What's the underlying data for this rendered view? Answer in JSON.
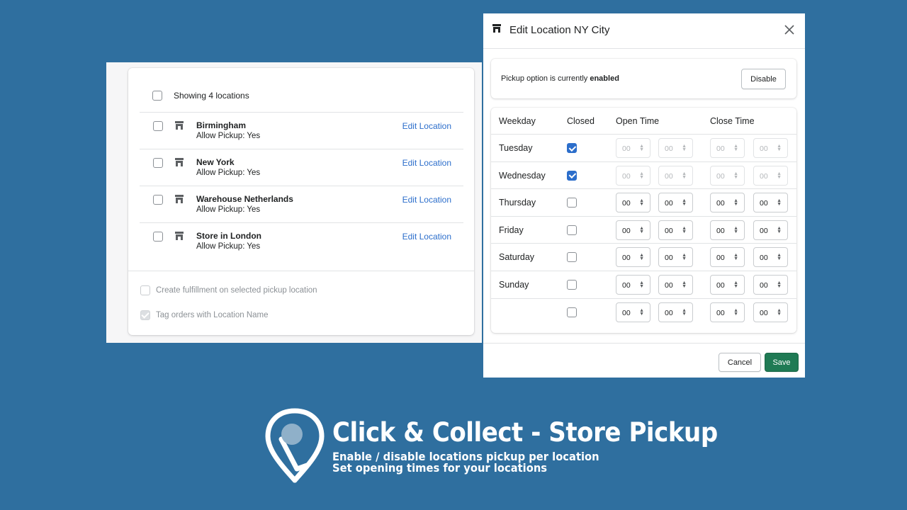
{
  "locations": {
    "header_label": "Showing 4 locations",
    "items": [
      {
        "name": "Birmingham",
        "allow": "Allow Pickup: Yes",
        "edit": "Edit Location"
      },
      {
        "name": "New York",
        "allow": "Allow Pickup: Yes",
        "edit": "Edit Location"
      },
      {
        "name": "Warehouse Netherlands",
        "allow": "Allow Pickup: Yes",
        "edit": "Edit Location"
      },
      {
        "name": "Store in London",
        "allow": "Allow Pickup: Yes",
        "edit": "Edit Location"
      }
    ],
    "options": {
      "fulfillment": {
        "label": "Create fulfillment on selected pickup location",
        "checked": false
      },
      "tag_orders": {
        "label": "Tag orders with Location Name",
        "checked": true
      }
    }
  },
  "modal": {
    "title": "Edit Location NY City",
    "status": {
      "prefix": "Pickup option is currently",
      "state": "enabled",
      "button": "Disable"
    },
    "table": {
      "headers": {
        "weekday": "Weekday",
        "closed": "Closed",
        "open": "Open Time",
        "close": "Close Time"
      },
      "rows": [
        {
          "day": "Tuesday",
          "closed": true,
          "open_h": "00",
          "open_m": "00",
          "close_h": "00",
          "close_m": "00"
        },
        {
          "day": "Wednesday",
          "closed": true,
          "open_h": "00",
          "open_m": "00",
          "close_h": "00",
          "close_m": "00"
        },
        {
          "day": "Thursday",
          "closed": false,
          "open_h": "00",
          "open_m": "00",
          "close_h": "00",
          "close_m": "00"
        },
        {
          "day": "Friday",
          "closed": false,
          "open_h": "00",
          "open_m": "00",
          "close_h": "00",
          "close_m": "00"
        },
        {
          "day": "Saturday",
          "closed": false,
          "open_h": "00",
          "open_m": "00",
          "close_h": "00",
          "close_m": "00"
        },
        {
          "day": "Sunday",
          "closed": false,
          "open_h": "00",
          "open_m": "00",
          "close_h": "00",
          "close_m": "00"
        },
        {
          "day": "",
          "closed": false,
          "open_h": "00",
          "open_m": "00",
          "close_h": "00",
          "close_m": "00"
        }
      ]
    },
    "footer": {
      "cancel": "Cancel",
      "save": "Save"
    }
  },
  "branding": {
    "title": "Click & Collect - Store Pickup",
    "line1": "Enable / disable locations pickup per location",
    "line2": "Set opening times for your locations"
  },
  "colors": {
    "background": "#2f6f9f",
    "link": "#2c6ecb",
    "save": "#1f7a54",
    "checkbox_checked": "#2c6ecb"
  }
}
